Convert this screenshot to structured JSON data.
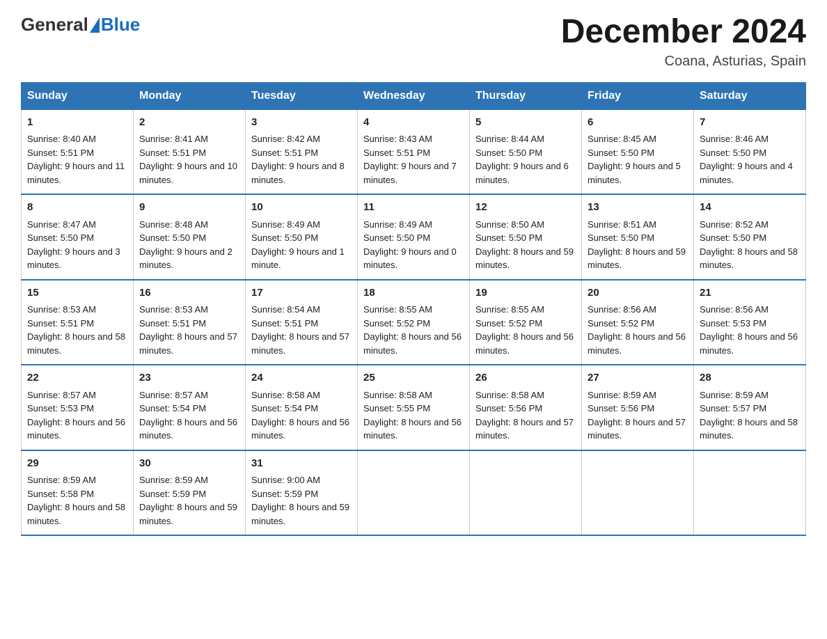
{
  "header": {
    "logo_general": "General",
    "logo_blue": "Blue",
    "month_year": "December 2024",
    "location": "Coana, Asturias, Spain"
  },
  "days_of_week": [
    "Sunday",
    "Monday",
    "Tuesday",
    "Wednesday",
    "Thursday",
    "Friday",
    "Saturday"
  ],
  "weeks": [
    [
      {
        "day": "1",
        "sunrise": "8:40 AM",
        "sunset": "5:51 PM",
        "daylight": "9 hours and 11 minutes."
      },
      {
        "day": "2",
        "sunrise": "8:41 AM",
        "sunset": "5:51 PM",
        "daylight": "9 hours and 10 minutes."
      },
      {
        "day": "3",
        "sunrise": "8:42 AM",
        "sunset": "5:51 PM",
        "daylight": "9 hours and 8 minutes."
      },
      {
        "day": "4",
        "sunrise": "8:43 AM",
        "sunset": "5:51 PM",
        "daylight": "9 hours and 7 minutes."
      },
      {
        "day": "5",
        "sunrise": "8:44 AM",
        "sunset": "5:50 PM",
        "daylight": "9 hours and 6 minutes."
      },
      {
        "day": "6",
        "sunrise": "8:45 AM",
        "sunset": "5:50 PM",
        "daylight": "9 hours and 5 minutes."
      },
      {
        "day": "7",
        "sunrise": "8:46 AM",
        "sunset": "5:50 PM",
        "daylight": "9 hours and 4 minutes."
      }
    ],
    [
      {
        "day": "8",
        "sunrise": "8:47 AM",
        "sunset": "5:50 PM",
        "daylight": "9 hours and 3 minutes."
      },
      {
        "day": "9",
        "sunrise": "8:48 AM",
        "sunset": "5:50 PM",
        "daylight": "9 hours and 2 minutes."
      },
      {
        "day": "10",
        "sunrise": "8:49 AM",
        "sunset": "5:50 PM",
        "daylight": "9 hours and 1 minute."
      },
      {
        "day": "11",
        "sunrise": "8:49 AM",
        "sunset": "5:50 PM",
        "daylight": "9 hours and 0 minutes."
      },
      {
        "day": "12",
        "sunrise": "8:50 AM",
        "sunset": "5:50 PM",
        "daylight": "8 hours and 59 minutes."
      },
      {
        "day": "13",
        "sunrise": "8:51 AM",
        "sunset": "5:50 PM",
        "daylight": "8 hours and 59 minutes."
      },
      {
        "day": "14",
        "sunrise": "8:52 AM",
        "sunset": "5:50 PM",
        "daylight": "8 hours and 58 minutes."
      }
    ],
    [
      {
        "day": "15",
        "sunrise": "8:53 AM",
        "sunset": "5:51 PM",
        "daylight": "8 hours and 58 minutes."
      },
      {
        "day": "16",
        "sunrise": "8:53 AM",
        "sunset": "5:51 PM",
        "daylight": "8 hours and 57 minutes."
      },
      {
        "day": "17",
        "sunrise": "8:54 AM",
        "sunset": "5:51 PM",
        "daylight": "8 hours and 57 minutes."
      },
      {
        "day": "18",
        "sunrise": "8:55 AM",
        "sunset": "5:52 PM",
        "daylight": "8 hours and 56 minutes."
      },
      {
        "day": "19",
        "sunrise": "8:55 AM",
        "sunset": "5:52 PM",
        "daylight": "8 hours and 56 minutes."
      },
      {
        "day": "20",
        "sunrise": "8:56 AM",
        "sunset": "5:52 PM",
        "daylight": "8 hours and 56 minutes."
      },
      {
        "day": "21",
        "sunrise": "8:56 AM",
        "sunset": "5:53 PM",
        "daylight": "8 hours and 56 minutes."
      }
    ],
    [
      {
        "day": "22",
        "sunrise": "8:57 AM",
        "sunset": "5:53 PM",
        "daylight": "8 hours and 56 minutes."
      },
      {
        "day": "23",
        "sunrise": "8:57 AM",
        "sunset": "5:54 PM",
        "daylight": "8 hours and 56 minutes."
      },
      {
        "day": "24",
        "sunrise": "8:58 AM",
        "sunset": "5:54 PM",
        "daylight": "8 hours and 56 minutes."
      },
      {
        "day": "25",
        "sunrise": "8:58 AM",
        "sunset": "5:55 PM",
        "daylight": "8 hours and 56 minutes."
      },
      {
        "day": "26",
        "sunrise": "8:58 AM",
        "sunset": "5:56 PM",
        "daylight": "8 hours and 57 minutes."
      },
      {
        "day": "27",
        "sunrise": "8:59 AM",
        "sunset": "5:56 PM",
        "daylight": "8 hours and 57 minutes."
      },
      {
        "day": "28",
        "sunrise": "8:59 AM",
        "sunset": "5:57 PM",
        "daylight": "8 hours and 58 minutes."
      }
    ],
    [
      {
        "day": "29",
        "sunrise": "8:59 AM",
        "sunset": "5:58 PM",
        "daylight": "8 hours and 58 minutes."
      },
      {
        "day": "30",
        "sunrise": "8:59 AM",
        "sunset": "5:59 PM",
        "daylight": "8 hours and 59 minutes."
      },
      {
        "day": "31",
        "sunrise": "9:00 AM",
        "sunset": "5:59 PM",
        "daylight": "8 hours and 59 minutes."
      },
      null,
      null,
      null,
      null
    ]
  ]
}
